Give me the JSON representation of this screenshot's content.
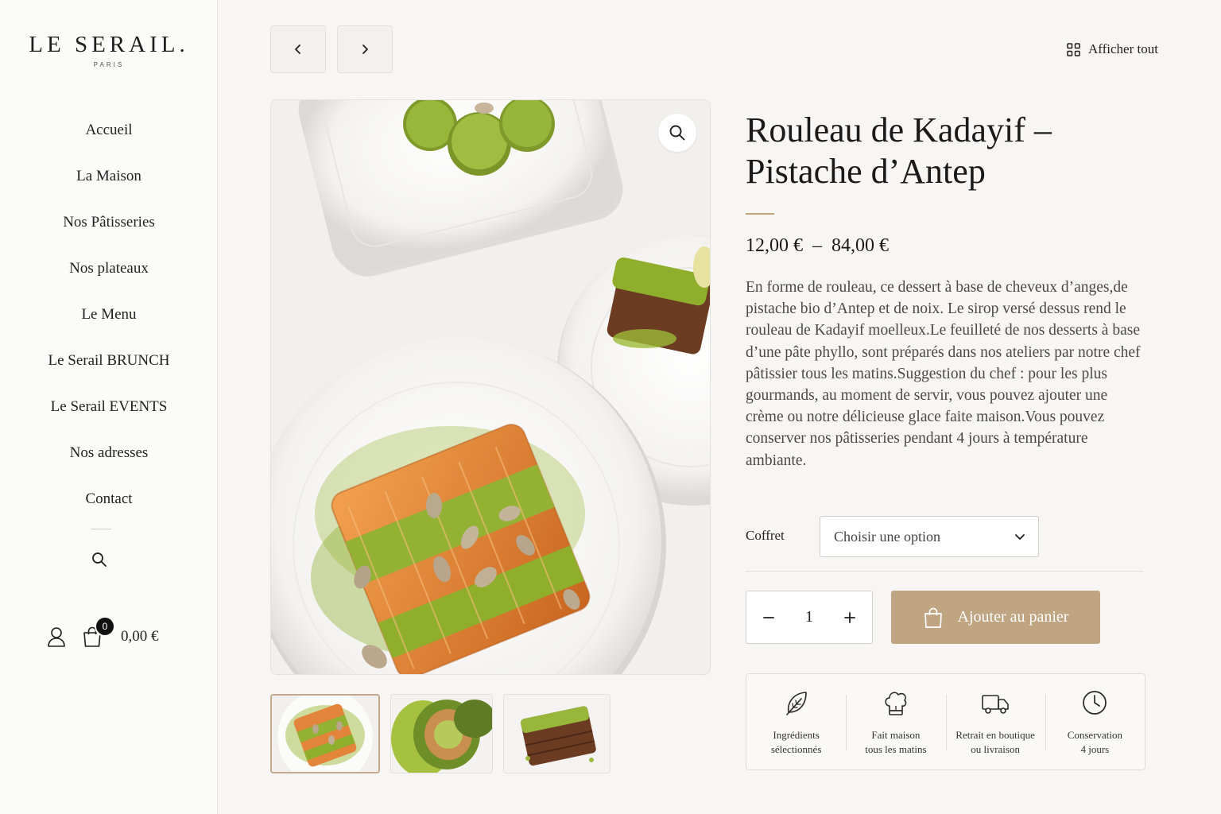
{
  "brand": {
    "name": "LE SERAIL.",
    "city": "PARIS"
  },
  "sidebar": {
    "nav": [
      {
        "label": "Accueil"
      },
      {
        "label": "La Maison"
      },
      {
        "label": "Nos Pâtisseries"
      },
      {
        "label": "Nos plateaux"
      },
      {
        "label": "Le Menu"
      },
      {
        "label": "Le Serail BRUNCH"
      },
      {
        "label": "Le Serail EVENTS"
      },
      {
        "label": "Nos adresses"
      },
      {
        "label": "Contact"
      }
    ],
    "icons": {
      "search": "search-icon",
      "account": "user-icon",
      "cart": "shopping-bag-icon"
    },
    "cart_count": "0",
    "cart_total": "0,00 €"
  },
  "topbar": {
    "prev_icon": "chevron-left-icon",
    "next_icon": "chevron-right-icon",
    "show_all_label": "Afficher tout",
    "show_all_icon": "grid-icon"
  },
  "gallery": {
    "zoom_icon": "magnifier-icon",
    "thumbnail_count": 3,
    "active_thumbnail": 1
  },
  "product": {
    "title": "Rouleau de Kadayif – Pistache d’Antep",
    "price_range": "12,00 €  –  84,00 €",
    "description": "En forme de rouleau, ce dessert à base de cheveux d’anges,de pistache bio d’Antep et de noix. Le sirop versé dessus rend le rouleau de Kadayif moelleux.Le feuilleté de nos desserts à base d’une pâte phyllo, sont préparés dans nos ateliers par notre chef pâtissier tous les matins.Suggestion du chef : pour les plus gourmands, au moment de servir, vous pouvez ajouter une crème ou notre délicieuse glace faite maison.Vous pouvez conserver nos pâtisseries pendant 4 jours à température ambiante.",
    "variant_label": "Coffret",
    "variant_placeholder": "Choisir une option",
    "quantity": "1",
    "add_to_cart_label": "Ajouter au panier"
  },
  "features": [
    {
      "icon": "leaf-icon",
      "text": "Ingrédients\nsélectionnés"
    },
    {
      "icon": "chef-hat-icon",
      "text": "Fait maison\ntous les matins"
    },
    {
      "icon": "truck-icon",
      "text": "Retrait en boutique\nou livraison"
    },
    {
      "icon": "clock-icon",
      "text": "Conservation\n4 jours"
    }
  ],
  "colors": {
    "accent": "#c0a582",
    "background": "#f7f6f4",
    "sidebar": "#fbfbfa",
    "pistachio": "#8fae2c",
    "kadayif": "#e2843a"
  }
}
